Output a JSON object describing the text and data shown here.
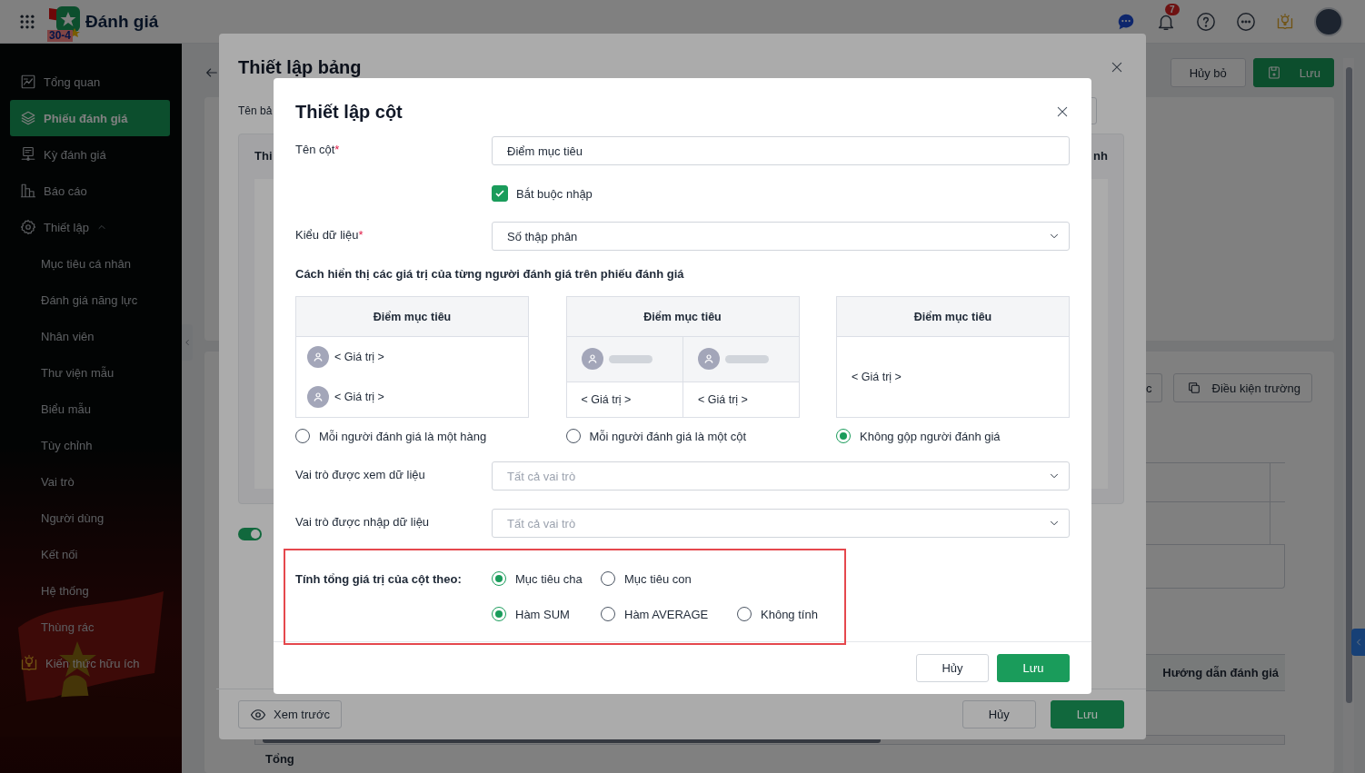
{
  "app_header": {
    "title": "Đánh giá",
    "logo_text": "30-4",
    "notification_count": "7"
  },
  "sidebar": {
    "items": [
      {
        "kind": "item",
        "label": "Tổng quan",
        "selected": false
      },
      {
        "kind": "item",
        "label": "Phiếu đánh giá",
        "selected": true
      },
      {
        "kind": "item",
        "label": "Kỳ đánh giá",
        "selected": false
      },
      {
        "kind": "item",
        "label": "Báo cáo",
        "selected": false
      },
      {
        "kind": "group",
        "label": "Thiết lập",
        "selected": false,
        "expanded": true,
        "children": [
          {
            "label": "Mục tiêu cá nhân",
            "selected": false
          },
          {
            "label": "Đánh giá năng lực",
            "selected": false
          },
          {
            "label": "Nhân viên",
            "selected": false
          },
          {
            "label": "Thư viện mẫu",
            "selected": false
          },
          {
            "label": "Biểu mẫu",
            "selected": false
          },
          {
            "label": "Tùy chỉnh",
            "selected": false
          },
          {
            "label": "Vai trò",
            "selected": false
          },
          {
            "label": "Người dùng",
            "selected": false
          },
          {
            "label": "Kết nối",
            "selected": false
          },
          {
            "label": "Hệ thống",
            "selected": false
          },
          {
            "label": "Thùng rác",
            "selected": false
          }
        ]
      },
      {
        "kind": "promo",
        "label": "Kiến thức hữu ích",
        "selected": false
      }
    ]
  },
  "page": {
    "cancel_button": "Hủy bỏ",
    "save_button": "Lưu",
    "tool_buttons": [
      "c",
      "Điều kiện trường"
    ],
    "table_header": "Hướng dẫn đánh giá",
    "total_row": "Tổng"
  },
  "table_dialog": {
    "title": "Thiết lập bảng",
    "name_label": "Tên bả",
    "section_title": "Thi",
    "section_title_right": "nh",
    "toggle_on": true,
    "preview_button": "Xem trước",
    "cancel_button": "Hủy",
    "save_button": "Lưu"
  },
  "column_dialog": {
    "title": "Thiết lập cột",
    "name_field": {
      "label": "Tên cột",
      "required_mark": "*",
      "value": "Điểm mục tiêu"
    },
    "required_checkbox": {
      "label": "Bắt buộc nhập",
      "checked": true
    },
    "data_type_field": {
      "label": "Kiểu dữ liệu",
      "required_mark": "*",
      "value": "Số thập phân"
    },
    "display_heading": "Cách hiển thị các giá trị của từng người đánh giá trên phiếu đánh giá",
    "display_options": [
      {
        "kind": "rows",
        "header": "Điểm mục tiêu",
        "values": [
          "< Giá trị >",
          "< Giá trị >"
        ],
        "label": "Mỗi người đánh giá là một hàng",
        "selected": false
      },
      {
        "kind": "columns",
        "header": "Điểm mục tiêu",
        "values": [
          "< Giá trị >",
          "< Giá trị >"
        ],
        "label": "Mỗi người đánh giá là một cột",
        "selected": false
      },
      {
        "kind": "merged",
        "header": "Điểm mục tiêu",
        "values": [
          "< Giá trị >"
        ],
        "label": "Không gộp người đánh giá",
        "selected": true
      }
    ],
    "view_roles_field": {
      "label": "Vai trò được xem dữ liệu",
      "placeholder": "Tất cả vai trò"
    },
    "input_roles_field": {
      "label": "Vai trò được nhập dữ liệu",
      "placeholder": "Tất cả vai trò"
    },
    "sum": {
      "highlighted": true,
      "label": "Tính tổng giá trị của cột theo:",
      "source_options": [
        {
          "label": "Mục tiêu cha",
          "selected": true
        },
        {
          "label": "Mục tiêu con",
          "selected": false
        }
      ],
      "function_options": [
        {
          "label": "Hàm SUM",
          "selected": true
        },
        {
          "label": "Hàm AVERAGE",
          "selected": false
        },
        {
          "label": "Không tính",
          "selected": false
        }
      ]
    },
    "cancel_button": "Hủy",
    "save_button": "Lưu"
  }
}
